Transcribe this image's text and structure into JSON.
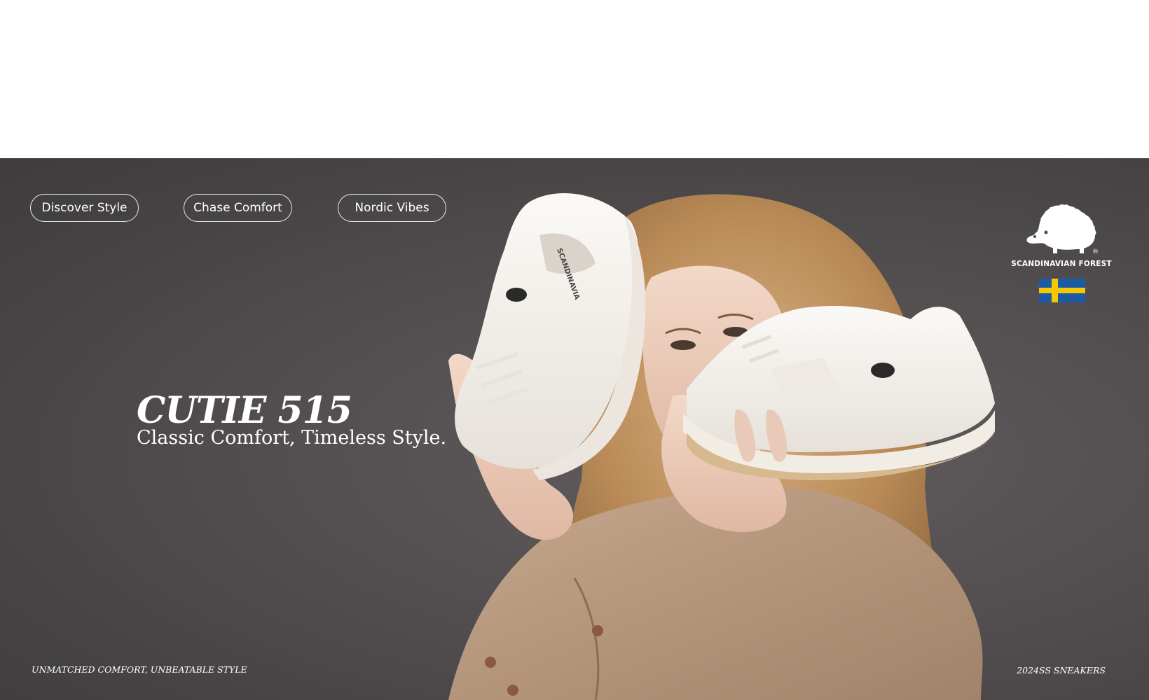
{
  "nav": {
    "pills": [
      "Discover Style",
      "Chase Comfort",
      "Nordic Vibes"
    ]
  },
  "hero": {
    "headline": "CUTIE 515",
    "tagline": "Classic Comfort, Timeless Style.",
    "footer_left": "UNMATCHED COMFORT, UNBEATABLE STYLE",
    "footer_right": "2024SS SNEAKERS"
  },
  "brand": {
    "name": "SCANDINAVIAN FOREST",
    "registered": "®",
    "logo_icon": "hedgehog-icon",
    "flag_icon": "sweden-flag-icon",
    "shoe_text": "SCANDINAVIA"
  },
  "colors": {
    "background": "#4f4b4c",
    "text": "#ffffff",
    "flag_blue": "#1c5aa6",
    "flag_yellow": "#f5c800"
  }
}
